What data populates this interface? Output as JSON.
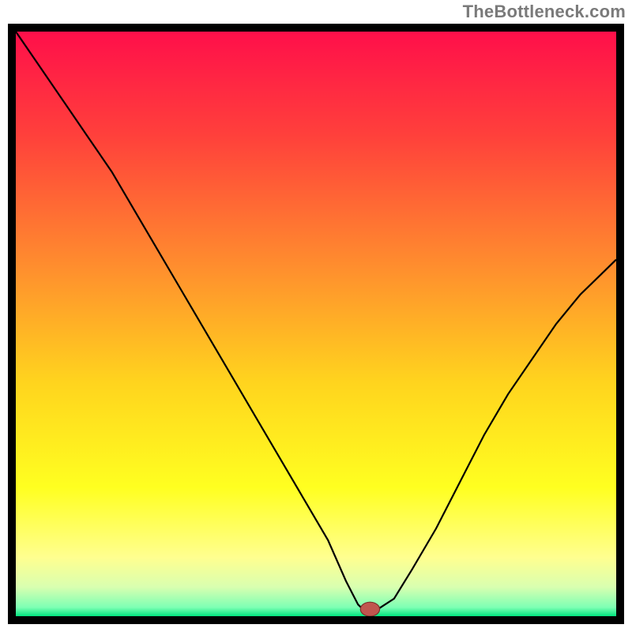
{
  "watermark": "TheBottleneck.com",
  "chart_data": {
    "type": "line",
    "title": "",
    "xlabel": "",
    "ylabel": "",
    "xlim": [
      0,
      100
    ],
    "ylim": [
      0,
      100
    ],
    "grid": false,
    "legend": false,
    "background": {
      "type": "vertical-gradient",
      "stops": [
        {
          "offset": 0.0,
          "color": "#ff0f4a"
        },
        {
          "offset": 0.18,
          "color": "#ff413b"
        },
        {
          "offset": 0.4,
          "color": "#ff8d2e"
        },
        {
          "offset": 0.6,
          "color": "#ffd41e"
        },
        {
          "offset": 0.78,
          "color": "#ffff20"
        },
        {
          "offset": 0.9,
          "color": "#ffff90"
        },
        {
          "offset": 0.95,
          "color": "#d9ffb0"
        },
        {
          "offset": 0.985,
          "color": "#7dffb4"
        },
        {
          "offset": 1.0,
          "color": "#00e37e"
        }
      ]
    },
    "series": [
      {
        "name": "bottleneck-curve",
        "color": "#000000",
        "width": 2.2,
        "x": [
          0,
          4,
          8,
          12,
          16,
          20,
          24,
          28,
          32,
          36,
          40,
          44,
          48,
          52,
          55,
          57,
          58,
          60,
          63,
          66,
          70,
          74,
          78,
          82,
          86,
          90,
          94,
          98,
          100
        ],
        "y": [
          100,
          94,
          88,
          82,
          76,
          69,
          62,
          55,
          48,
          41,
          34,
          27,
          20,
          13,
          6,
          2,
          1,
          1,
          3,
          8,
          15,
          23,
          31,
          38,
          44,
          50,
          55,
          59,
          61
        ]
      }
    ],
    "marker": {
      "name": "optimal-point",
      "x": 59,
      "y": 1.2,
      "rx": 1.6,
      "ry": 1.2,
      "fill": "#c0564f",
      "stroke": "#7a2d28"
    }
  }
}
